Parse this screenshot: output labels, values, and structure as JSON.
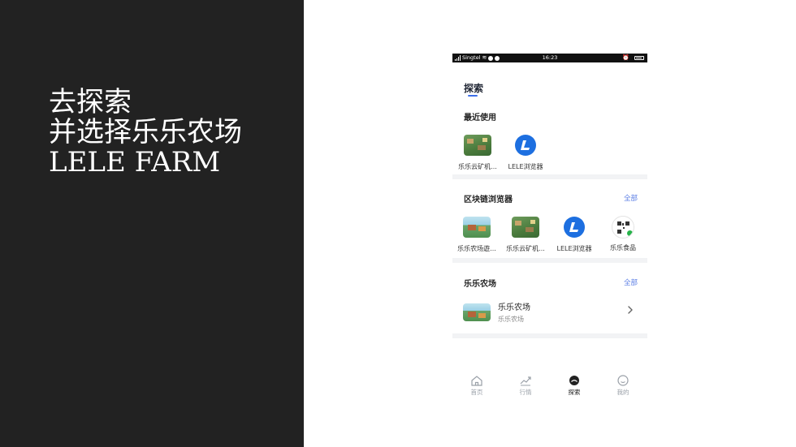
{
  "slide": {
    "headline_lines": [
      "去探索",
      "并选择乐乐农场",
      "LELE FARM"
    ]
  },
  "status_bar": {
    "carrier": "Singtel",
    "time": "16:23"
  },
  "page": {
    "title": "探索"
  },
  "recent": {
    "title": "最近使用",
    "apps": [
      {
        "label": "乐乐云矿机...",
        "icon": "mine-game-icon"
      },
      {
        "label": "LELE浏览器",
        "icon": "lele-browser-icon"
      }
    ]
  },
  "blockchain_browser": {
    "title": "区块链浏览器",
    "see_all": "全部",
    "apps": [
      {
        "label": "乐乐农场遊...",
        "icon": "farm-game-icon"
      },
      {
        "label": "乐乐云矿机...",
        "icon": "mine-game-icon"
      },
      {
        "label": "LELE浏览器",
        "icon": "lele-browser-icon"
      },
      {
        "label": "乐乐食品",
        "icon": "qr-code-icon"
      }
    ]
  },
  "lele_farm": {
    "title": "乐乐农场",
    "see_all": "全部",
    "item": {
      "title": "乐乐农场",
      "subtitle": "乐乐农场"
    }
  },
  "tabbar": {
    "tabs": [
      {
        "label": "首页",
        "icon": "home-icon",
        "active": false
      },
      {
        "label": "行情",
        "icon": "trend-icon",
        "active": false
      },
      {
        "label": "探索",
        "icon": "explore-icon",
        "active": true
      },
      {
        "label": "我的",
        "icon": "profile-icon",
        "active": false
      }
    ]
  },
  "colors": {
    "left_panel": "#222222",
    "accent": "#3d6ee8",
    "link": "#5b7ee5",
    "divider": "#f2f3f5"
  }
}
